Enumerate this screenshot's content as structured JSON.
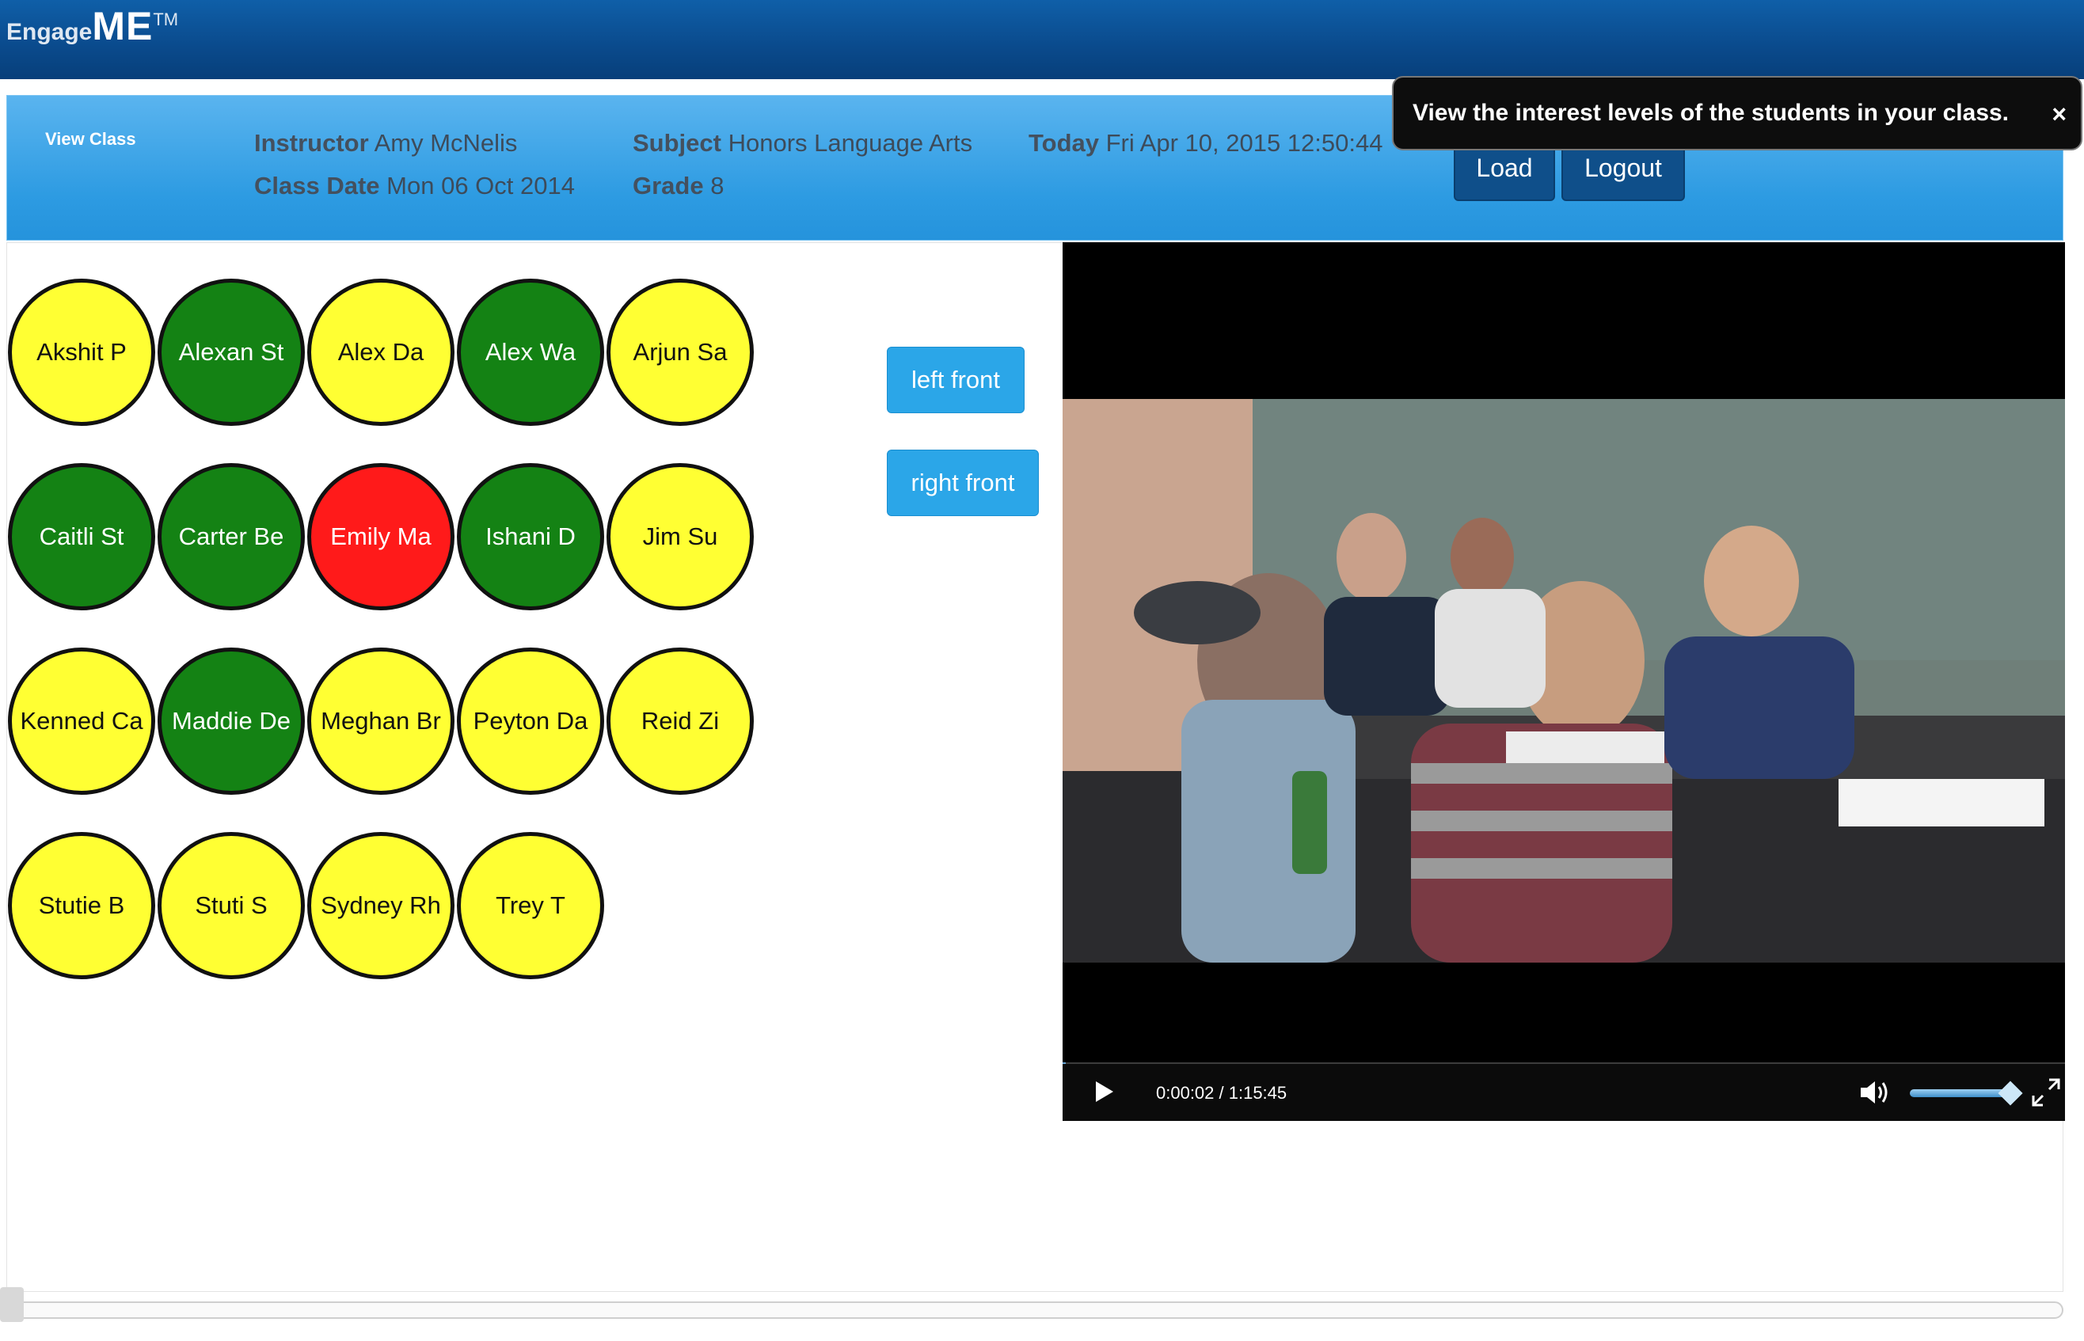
{
  "app": {
    "brand_engage": "Engage",
    "brand_me": "ME",
    "brand_tm": "TM"
  },
  "info": {
    "view_class": "View Class",
    "instructor_label": "Instructor",
    "instructor_value": "Amy McNelis",
    "class_date_label": "Class Date",
    "class_date_value": "Mon 06 Oct 2014",
    "subject_label": "Subject",
    "subject_value": "Honors Language Arts",
    "grade_label": "Grade",
    "grade_value": "8",
    "today_label": "Today",
    "today_value": "Fri Apr 10, 2015 12:50:44"
  },
  "buttons": {
    "load": "Load",
    "logout": "Logout",
    "left_front": "left front",
    "right_front": "right front"
  },
  "tooltip": {
    "text": "View the interest levels of the students in your class.",
    "close": "×"
  },
  "colors": {
    "yellow": "#ffff33",
    "green": "#148214",
    "red": "#ff1a1a"
  },
  "students": [
    {
      "name": "Akshit P",
      "status": "yellow"
    },
    {
      "name": "Alexan St",
      "status": "green"
    },
    {
      "name": "Alex Da",
      "status": "yellow"
    },
    {
      "name": "Alex Wa",
      "status": "green"
    },
    {
      "name": "Arjun Sa",
      "status": "yellow"
    },
    {
      "name": "Caitli St",
      "status": "green"
    },
    {
      "name": "Carter Be",
      "status": "green"
    },
    {
      "name": "Emily Ma",
      "status": "red"
    },
    {
      "name": "Ishani D",
      "status": "green"
    },
    {
      "name": "Jim Su",
      "status": "yellow"
    },
    {
      "name": "Kenned Ca",
      "status": "yellow"
    },
    {
      "name": "Maddie De",
      "status": "green"
    },
    {
      "name": "Meghan Br",
      "status": "yellow"
    },
    {
      "name": "Peyton Da",
      "status": "yellow"
    },
    {
      "name": "Reid Zi",
      "status": "yellow"
    },
    {
      "name": "Stutie B",
      "status": "yellow"
    },
    {
      "name": "Stuti S",
      "status": "yellow"
    },
    {
      "name": "Sydney Rh",
      "status": "yellow"
    },
    {
      "name": "Trey T",
      "status": "yellow"
    }
  ],
  "video": {
    "time": "0:00:02 / 1:15:45",
    "progress_fraction": 0.0004,
    "volume_fraction": 0.95
  }
}
